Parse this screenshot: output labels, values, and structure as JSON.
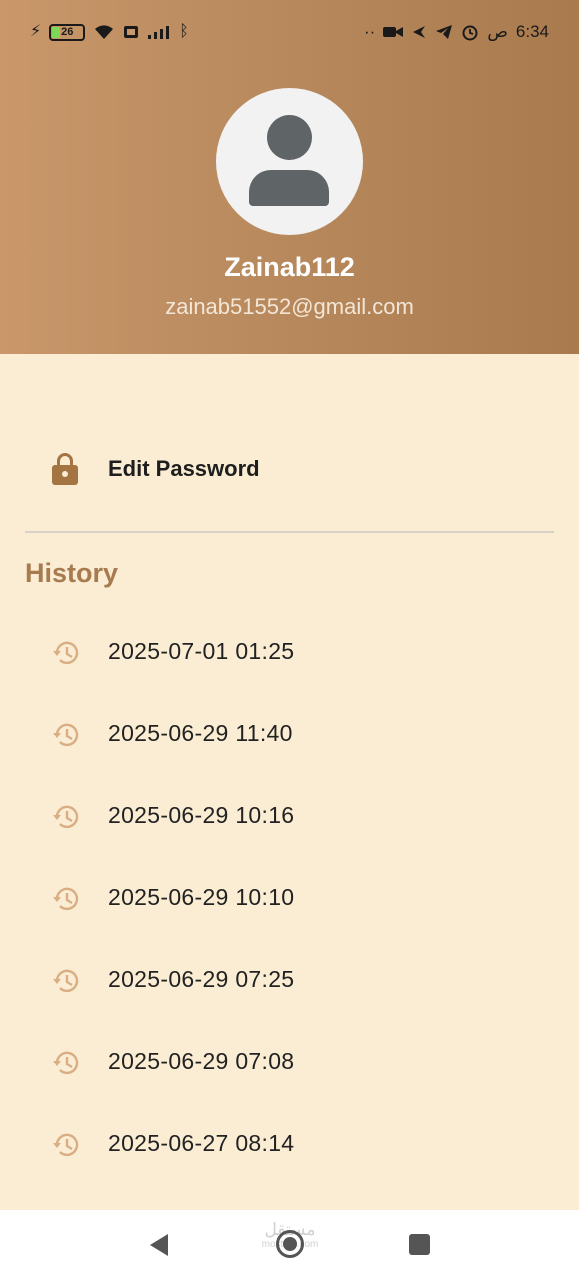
{
  "status_bar": {
    "battery": "26",
    "time": "6:34",
    "am_pm": "ص",
    "dots": "··"
  },
  "profile": {
    "username": "Zainab112",
    "email": "zainab51552@gmail.com"
  },
  "menu": {
    "edit_password_label": "Edit Password"
  },
  "history": {
    "title": "History",
    "items": [
      {
        "label": "2025-07-01 01:25"
      },
      {
        "label": "2025-06-29 11:40"
      },
      {
        "label": "2025-06-29 10:16"
      },
      {
        "label": "2025-06-29 10:10"
      },
      {
        "label": "2025-06-29 07:25"
      },
      {
        "label": "2025-06-29 07:08"
      },
      {
        "label": "2025-06-27 08:14"
      }
    ]
  },
  "watermark": {
    "text": "مستقل",
    "sub": "mostaql.com"
  },
  "colors": {
    "header_gradient_start": "#C9976A",
    "header_gradient_end": "#A87A4D",
    "background": "#FAEDD3",
    "accent": "#A77B4F",
    "history_icon": "#D9AE84"
  },
  "icons": {
    "avatar": "person-icon",
    "lock": "lock-icon",
    "history": "history-icon"
  }
}
